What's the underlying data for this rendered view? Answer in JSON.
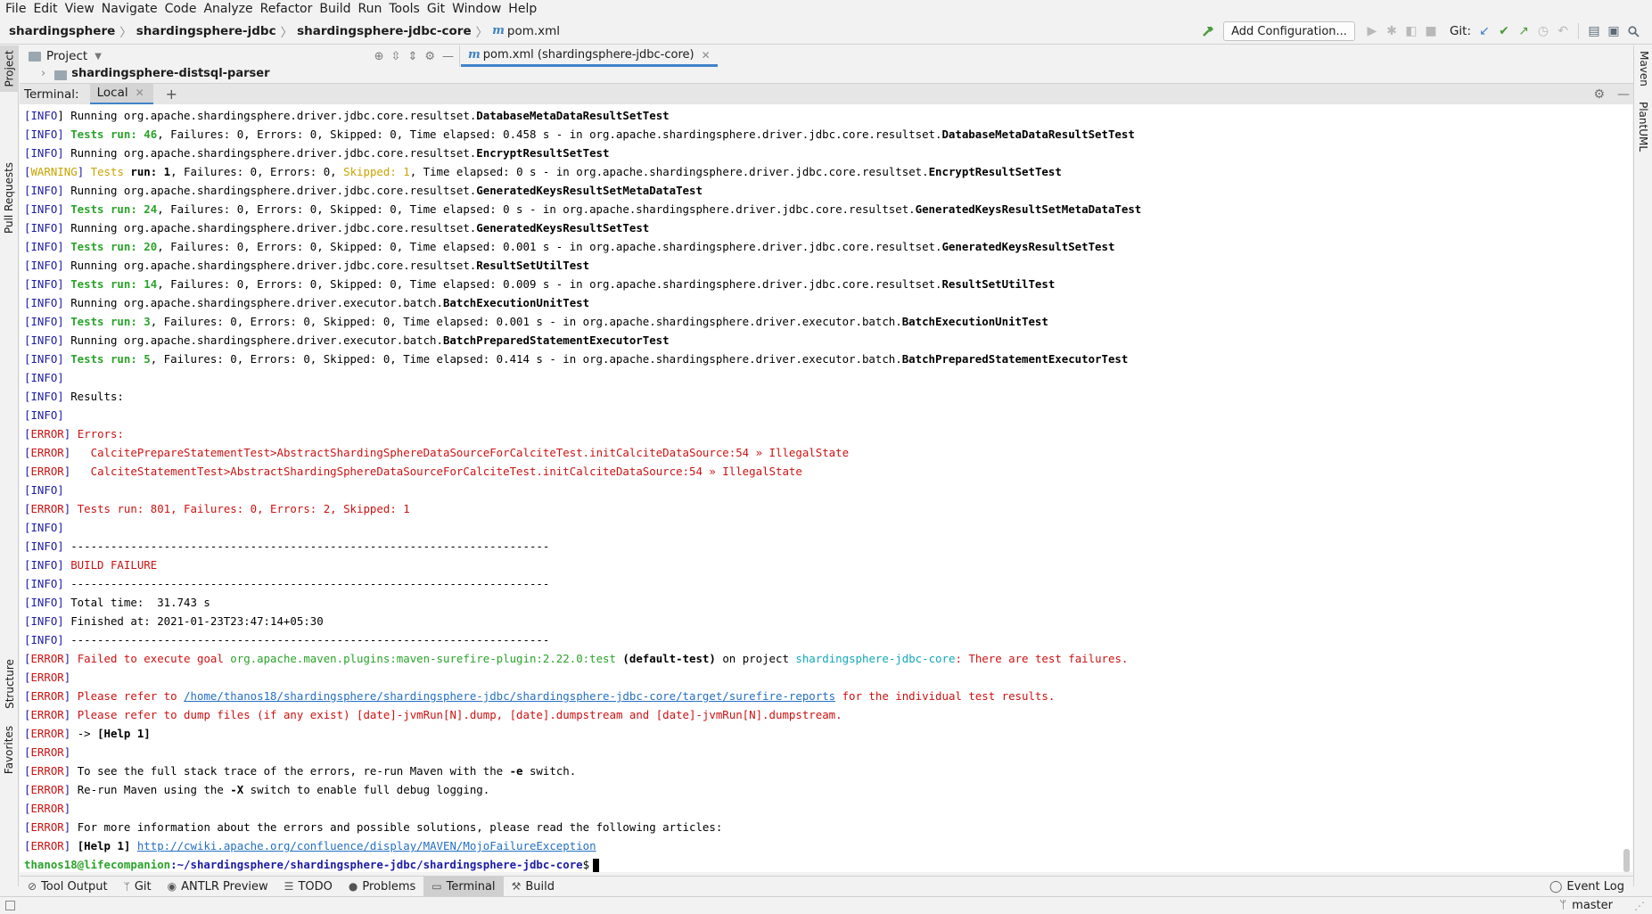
{
  "menu": [
    "File",
    "Edit",
    "View",
    "Navigate",
    "Code",
    "Analyze",
    "Refactor",
    "Build",
    "Run",
    "Tools",
    "Git",
    "Window",
    "Help"
  ],
  "breadcrumbs": [
    "shardingsphere",
    "shardingsphere-jdbc",
    "shardingsphere-jdbc-core",
    "pom.xml"
  ],
  "toolbar": {
    "add_configuration": "Add Configuration...",
    "git_label": "Git:"
  },
  "left_strip": {
    "project": "Project",
    "pull_requests": "Pull Requests",
    "structure": "Structure",
    "favorites": "Favorites"
  },
  "right_strip": {
    "maven": "Maven",
    "plantuml": "PlantUML"
  },
  "project_panel": {
    "title": "Project",
    "row_label": "shardingsphere-distsql-parser"
  },
  "editor_tab": {
    "label": "pom.xml (shardingsphere-jdbc-core)"
  },
  "terminal": {
    "title": "Terminal:",
    "tab_label": "Local",
    "lines": [
      [
        {
          "t": "[",
          "c": "t-info"
        },
        {
          "t": "INFO",
          "c": "t-info"
        },
        {
          "t": "] Running org.apache.shardingsphere.driver.jdbc.core.resultset."
        },
        {
          "t": "DatabaseMetaDataResultSetTest",
          "c": "b"
        }
      ],
      [
        {
          "t": "[INFO] ",
          "c": "t-info"
        },
        {
          "t": "Tests run: 46",
          "c": "t-green b"
        },
        {
          "t": ", Failures: 0, Errors: 0, Skipped: 0, Time elapsed: 0.458 s - in org.apache.shardingsphere.driver.jdbc.core.resultset."
        },
        {
          "t": "DatabaseMetaDataResultSetTest",
          "c": "b"
        }
      ],
      [
        {
          "t": "[INFO] ",
          "c": "t-info"
        },
        {
          "t": "Running org.apache.shardingsphere.driver.jdbc.core.resultset."
        },
        {
          "t": "EncryptResultSetTest",
          "c": "b"
        }
      ],
      [
        {
          "t": "[",
          "c": "t-info"
        },
        {
          "t": "WARNING",
          "c": "t-warn"
        },
        {
          "t": "] ",
          "c": "t-info"
        },
        {
          "t": "Tests ",
          "c": "t-warn"
        },
        {
          "t": "run: 1",
          "c": "b"
        },
        {
          "t": ", Failures: 0, Errors: 0, "
        },
        {
          "t": "Skipped: 1",
          "c": "t-warn"
        },
        {
          "t": ", Time elapsed: 0 s - in org.apache.shardingsphere.driver.jdbc.core.resultset."
        },
        {
          "t": "EncryptResultSetTest",
          "c": "b"
        }
      ],
      [
        {
          "t": "[INFO] ",
          "c": "t-info"
        },
        {
          "t": "Running org.apache.shardingsphere.driver.jdbc.core.resultset."
        },
        {
          "t": "GeneratedKeysResultSetMetaDataTest",
          "c": "b"
        }
      ],
      [
        {
          "t": "[INFO] ",
          "c": "t-info"
        },
        {
          "t": "Tests run: 24",
          "c": "t-green b"
        },
        {
          "t": ", Failures: 0, Errors: 0, Skipped: 0, Time elapsed: 0 s - in org.apache.shardingsphere.driver.jdbc.core.resultset."
        },
        {
          "t": "GeneratedKeysResultSetMetaDataTest",
          "c": "b"
        }
      ],
      [
        {
          "t": "[INFO] ",
          "c": "t-info"
        },
        {
          "t": "Running org.apache.shardingsphere.driver.jdbc.core.resultset."
        },
        {
          "t": "GeneratedKeysResultSetTest",
          "c": "b"
        }
      ],
      [
        {
          "t": "[INFO] ",
          "c": "t-info"
        },
        {
          "t": "Tests run: 20",
          "c": "t-green b"
        },
        {
          "t": ", Failures: 0, Errors: 0, Skipped: 0, Time elapsed: 0.001 s - in org.apache.shardingsphere.driver.jdbc.core.resultset."
        },
        {
          "t": "GeneratedKeysResultSetTest",
          "c": "b"
        }
      ],
      [
        {
          "t": "[INFO] ",
          "c": "t-info"
        },
        {
          "t": "Running org.apache.shardingsphere.driver.jdbc.core.resultset."
        },
        {
          "t": "ResultSetUtilTest",
          "c": "b"
        }
      ],
      [
        {
          "t": "[INFO] ",
          "c": "t-info"
        },
        {
          "t": "Tests run: 14",
          "c": "t-green b"
        },
        {
          "t": ", Failures: 0, Errors: 0, Skipped: 0, Time elapsed: 0.009 s - in org.apache.shardingsphere.driver.jdbc.core.resultset."
        },
        {
          "t": "ResultSetUtilTest",
          "c": "b"
        }
      ],
      [
        {
          "t": "[INFO] ",
          "c": "t-info"
        },
        {
          "t": "Running org.apache.shardingsphere.driver.executor.batch."
        },
        {
          "t": "BatchExecutionUnitTest",
          "c": "b"
        }
      ],
      [
        {
          "t": "[INFO] ",
          "c": "t-info"
        },
        {
          "t": "Tests run: 3",
          "c": "t-green b"
        },
        {
          "t": ", Failures: 0, Errors: 0, Skipped: 0, Time elapsed: 0.001 s - in org.apache.shardingsphere.driver.executor.batch."
        },
        {
          "t": "BatchExecutionUnitTest",
          "c": "b"
        }
      ],
      [
        {
          "t": "[INFO] ",
          "c": "t-info"
        },
        {
          "t": "Running org.apache.shardingsphere.driver.executor.batch."
        },
        {
          "t": "BatchPreparedStatementExecutorTest",
          "c": "b"
        }
      ],
      [
        {
          "t": "[INFO] ",
          "c": "t-info"
        },
        {
          "t": "Tests run: 5",
          "c": "t-green b"
        },
        {
          "t": ", Failures: 0, Errors: 0, Skipped: 0, Time elapsed: 0.414 s - in org.apache.shardingsphere.driver.executor.batch."
        },
        {
          "t": "BatchPreparedStatementExecutorTest",
          "c": "b"
        }
      ],
      [
        {
          "t": "[INFO]",
          "c": "t-info"
        }
      ],
      [
        {
          "t": "[INFO] ",
          "c": "t-info"
        },
        {
          "t": "Results:"
        }
      ],
      [
        {
          "t": "[INFO]",
          "c": "t-info"
        }
      ],
      [
        {
          "t": "[",
          "c": "t-info"
        },
        {
          "t": "ERROR",
          "c": "t-red"
        },
        {
          "t": "] ",
          "c": "t-info"
        },
        {
          "t": "Errors:",
          "c": "t-red"
        }
      ],
      [
        {
          "t": "[",
          "c": "t-info"
        },
        {
          "t": "ERROR",
          "c": "t-red"
        },
        {
          "t": "]   ",
          "c": "t-info"
        },
        {
          "t": "CalcitePrepareStatementTest>AbstractShardingSphereDataSourceForCalciteTest.initCalciteDataSource:54 » IllegalState",
          "c": "t-red"
        }
      ],
      [
        {
          "t": "[",
          "c": "t-info"
        },
        {
          "t": "ERROR",
          "c": "t-red"
        },
        {
          "t": "]   ",
          "c": "t-info"
        },
        {
          "t": "CalciteStatementTest>AbstractShardingSphereDataSourceForCalciteTest.initCalciteDataSource:54 » IllegalState",
          "c": "t-red"
        }
      ],
      [
        {
          "t": "[INFO]",
          "c": "t-info"
        }
      ],
      [
        {
          "t": "[",
          "c": "t-info"
        },
        {
          "t": "ERROR",
          "c": "t-red"
        },
        {
          "t": "] ",
          "c": "t-info"
        },
        {
          "t": "Tests run: 801, Failures: 0, Errors: 2, Skipped: 1",
          "c": "t-red"
        }
      ],
      [
        {
          "t": "[INFO]",
          "c": "t-info"
        }
      ],
      [
        {
          "t": "[INFO] ",
          "c": "t-info"
        },
        {
          "t": "------------------------------------------------------------------------"
        }
      ],
      [
        {
          "t": "[INFO] ",
          "c": "t-info"
        },
        {
          "t": "BUILD FAILURE",
          "c": "t-red"
        }
      ],
      [
        {
          "t": "[INFO] ",
          "c": "t-info"
        },
        {
          "t": "------------------------------------------------------------------------"
        }
      ],
      [
        {
          "t": "[INFO] ",
          "c": "t-info"
        },
        {
          "t": "Total time:  31.743 s"
        }
      ],
      [
        {
          "t": "[INFO] ",
          "c": "t-info"
        },
        {
          "t": "Finished at: 2021-01-23T23:47:14+05:30"
        }
      ],
      [
        {
          "t": "[INFO] ",
          "c": "t-info"
        },
        {
          "t": "------------------------------------------------------------------------"
        }
      ],
      [
        {
          "t": "[",
          "c": "t-info"
        },
        {
          "t": "ERROR",
          "c": "t-red"
        },
        {
          "t": "] ",
          "c": "t-info"
        },
        {
          "t": "Failed to execute goal ",
          "c": "t-red"
        },
        {
          "t": "org.apache.maven.plugins:maven-surefire-plugin:2.22.0:test",
          "c": "t-green"
        },
        {
          "t": " (default-test)",
          "c": "b"
        },
        {
          "t": " on project "
        },
        {
          "t": "shardingsphere-jdbc-core",
          "c": "t-cyan"
        },
        {
          "t": ": There are test failures.",
          "c": "t-red"
        }
      ],
      [
        {
          "t": "[",
          "c": "t-info"
        },
        {
          "t": "ERROR",
          "c": "t-red"
        },
        {
          "t": "]",
          "c": "t-info"
        }
      ],
      [
        {
          "t": "[",
          "c": "t-info"
        },
        {
          "t": "ERROR",
          "c": "t-red"
        },
        {
          "t": "] ",
          "c": "t-info"
        },
        {
          "t": "Please refer to ",
          "c": "t-red"
        },
        {
          "t": "/home/thanos18/shardingsphere/shardingsphere-jdbc/shardingsphere-jdbc-core/target/surefire-reports",
          "c": "t-link"
        },
        {
          "t": " for the individual test results.",
          "c": "t-red"
        }
      ],
      [
        {
          "t": "[",
          "c": "t-info"
        },
        {
          "t": "ERROR",
          "c": "t-red"
        },
        {
          "t": "] ",
          "c": "t-info"
        },
        {
          "t": "Please refer to dump files (if any exist) [date]-jvmRun[N].dump, [date].dumpstream and [date]-jvmRun[N].dumpstream.",
          "c": "t-red"
        }
      ],
      [
        {
          "t": "[",
          "c": "t-info"
        },
        {
          "t": "ERROR",
          "c": "t-red"
        },
        {
          "t": "] ",
          "c": "t-info"
        },
        {
          "t": "-> "
        },
        {
          "t": "[Help 1]",
          "c": "b"
        }
      ],
      [
        {
          "t": "[",
          "c": "t-info"
        },
        {
          "t": "ERROR",
          "c": "t-red"
        },
        {
          "t": "]",
          "c": "t-info"
        }
      ],
      [
        {
          "t": "[",
          "c": "t-info"
        },
        {
          "t": "ERROR",
          "c": "t-red"
        },
        {
          "t": "] ",
          "c": "t-info"
        },
        {
          "t": "To see the full stack trace of the errors, re-run Maven with the "
        },
        {
          "t": "-e",
          "c": "b"
        },
        {
          "t": " switch."
        }
      ],
      [
        {
          "t": "[",
          "c": "t-info"
        },
        {
          "t": "ERROR",
          "c": "t-red"
        },
        {
          "t": "] ",
          "c": "t-info"
        },
        {
          "t": "Re-run Maven using the "
        },
        {
          "t": "-X",
          "c": "b"
        },
        {
          "t": " switch to enable full debug logging."
        }
      ],
      [
        {
          "t": "[",
          "c": "t-info"
        },
        {
          "t": "ERROR",
          "c": "t-red"
        },
        {
          "t": "]",
          "c": "t-info"
        }
      ],
      [
        {
          "t": "[",
          "c": "t-info"
        },
        {
          "t": "ERROR",
          "c": "t-red"
        },
        {
          "t": "] ",
          "c": "t-info"
        },
        {
          "t": "For more information about the errors and possible solutions, please read the following articles:"
        }
      ],
      [
        {
          "t": "[",
          "c": "t-info"
        },
        {
          "t": "ERROR",
          "c": "t-red"
        },
        {
          "t": "] ",
          "c": "t-info"
        },
        {
          "t": "[Help 1] ",
          "c": "b"
        },
        {
          "t": "http://cwiki.apache.org/confluence/display/MAVEN/MojoFailureException",
          "c": "t-link"
        }
      ]
    ],
    "prompt_user": "thanos18@lifecompanion",
    "prompt_path": ":~/shardingsphere/shardingsphere-jdbc/shardingsphere-jdbc-core",
    "prompt_symbol": "$"
  },
  "bottom_tabs": [
    {
      "label": "Tool Output",
      "icon": "tool-output-icon",
      "glyph": "⊘"
    },
    {
      "label": "Git",
      "icon": "git-branch-icon",
      "glyph": "ᛘ"
    },
    {
      "label": "ANTLR Preview",
      "icon": "antlr-icon",
      "glyph": "◉"
    },
    {
      "label": "TODO",
      "icon": "todo-list-icon",
      "glyph": "☰"
    },
    {
      "label": "Problems",
      "icon": "problems-icon",
      "glyph": "●"
    },
    {
      "label": "Terminal",
      "icon": "terminal-icon",
      "glyph": "▭",
      "active": true
    },
    {
      "label": "Build",
      "icon": "build-hammer-icon",
      "glyph": "⚒"
    }
  ],
  "event_log": "Event Log",
  "status": {
    "branch": "master"
  }
}
